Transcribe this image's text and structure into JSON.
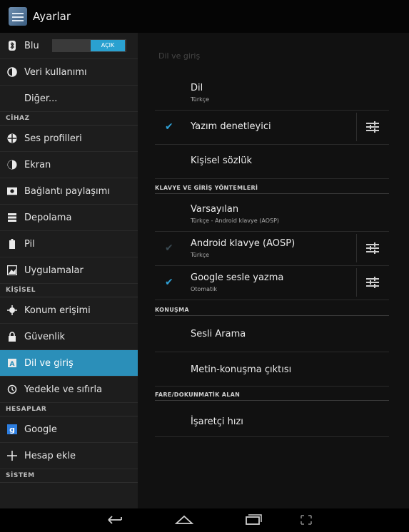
{
  "app": {
    "title": "Ayarlar"
  },
  "sidebar": {
    "bluetooth": {
      "label": "Blu",
      "toggle": "AÇIK"
    },
    "items_top": [
      {
        "label": "Veri kullanımı",
        "icon": "data-usage-icon"
      },
      {
        "label": "Diğer...",
        "icon": ""
      }
    ],
    "header_device": "CİHAZ",
    "items_device": [
      {
        "label": "Ses profilleri",
        "icon": "sound-profiles-icon"
      },
      {
        "label": "Ekran",
        "icon": "display-icon"
      },
      {
        "label": "Bağlantı paylaşımı",
        "icon": "tethering-icon"
      },
      {
        "label": "Depolama",
        "icon": "storage-icon"
      },
      {
        "label": "Pil",
        "icon": "battery-icon"
      },
      {
        "label": "Uygulamalar",
        "icon": "apps-icon"
      }
    ],
    "header_personal": "KİŞİSEL",
    "items_personal": [
      {
        "label": "Konum erişimi",
        "icon": "location-icon"
      },
      {
        "label": "Güvenlik",
        "icon": "lock-icon"
      },
      {
        "label": "Dil ve giriş",
        "icon": "language-input-icon",
        "active": true
      },
      {
        "label": "Yedekle ve sıfırla",
        "icon": "backup-reset-icon"
      }
    ],
    "header_accounts": "HESAPLAR",
    "items_accounts": [
      {
        "label": "Google",
        "icon": "google-icon"
      },
      {
        "label": "Hesap ekle",
        "icon": "add-icon"
      }
    ],
    "header_system": "SİSTEM"
  },
  "main": {
    "section_title": "Dil ve giriş",
    "language": {
      "label": "Dil",
      "value": "Türkçe"
    },
    "spell_checker": {
      "label": "Yazım denetleyici",
      "checked": true
    },
    "personal_dictionary": {
      "label": "Kişisel sözlük"
    },
    "category_keyboard": "KLAVYE VE GİRİŞ YÖNTEMLERİ",
    "default_keyboard": {
      "label": "Varsayılan",
      "value": "Türkçe - Android klavye (AOSP)"
    },
    "android_keyboard": {
      "label": "Android klavye (AOSP)",
      "value": "Türkçe",
      "checked": true
    },
    "google_voice": {
      "label": "Google sesle yazma",
      "value": "Otomatik",
      "checked": true
    },
    "category_speech": "KONUŞMA",
    "voice_search": {
      "label": "Sesli Arama"
    },
    "tts_output": {
      "label": "Metin-konuşma çıktısı"
    },
    "category_mouse": "FARE/DOKUNMATİK ALAN",
    "pointer_speed": {
      "label": "İşaretçi hızı"
    }
  },
  "colors": {
    "accent": "#2b8fb9",
    "check": "#2fa0d5"
  }
}
